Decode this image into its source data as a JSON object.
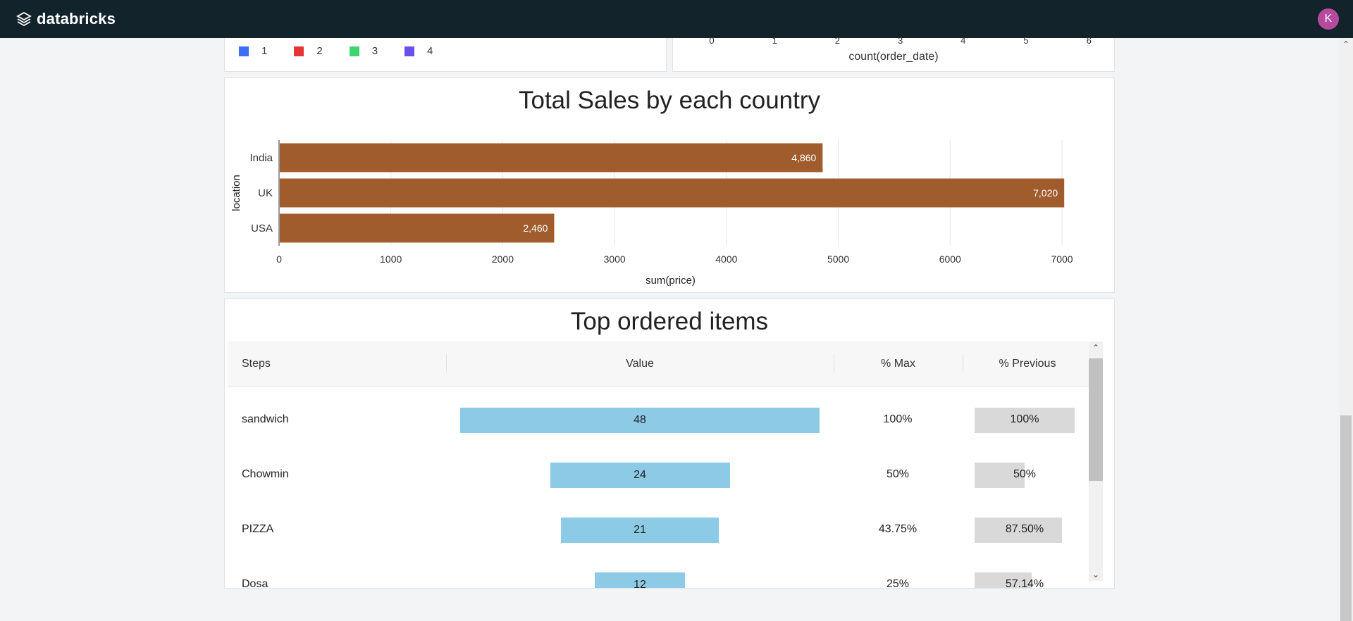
{
  "app": {
    "brand": "databricks",
    "user_initial": "K"
  },
  "colors": {
    "topbar": "#13232c",
    "bar_brown": "#a05c2c",
    "funnel_blue": "#8dcae6",
    "prev_gray": "#d9d9d9",
    "avatar": "#b64a9e"
  },
  "top_left_panel": {
    "legend": [
      {
        "label": "1",
        "color": "#3b6ff5"
      },
      {
        "label": "2",
        "color": "#e53535"
      },
      {
        "label": "3",
        "color": "#3ed46f"
      },
      {
        "label": "4",
        "color": "#6a4fe8"
      }
    ]
  },
  "top_right_panel": {
    "ticks": [
      "0",
      "1",
      "2",
      "3",
      "4",
      "5",
      "6"
    ],
    "xlabel": "count(order_date)"
  },
  "sales_chart": {
    "title": "Total Sales by each country",
    "ylabel": "location",
    "xlabel": "sum(price)",
    "ticks": [
      "0",
      "1000",
      "2000",
      "3000",
      "4000",
      "5000",
      "6000",
      "7000"
    ]
  },
  "chart_data": {
    "type": "bar",
    "orientation": "horizontal",
    "title": "Total Sales by each country",
    "xlabel": "sum(price)",
    "ylabel": "location",
    "categories": [
      "India",
      "UK",
      "USA"
    ],
    "values": [
      4860,
      7020,
      2460
    ],
    "value_labels": [
      "4,860",
      "7,020",
      "2,460"
    ],
    "xlim": [
      0,
      7400
    ],
    "color": "#a05c2c",
    "grid": true
  },
  "funnel": {
    "title": "Top ordered items",
    "headers": {
      "steps": "Steps",
      "value": "Value",
      "pct_max": "% Max",
      "pct_prev": "% Previous"
    },
    "rows": [
      {
        "step": "sandwich",
        "value": "48",
        "pct_max": "100%",
        "pct_prev": "100%",
        "frac_max": 1.0,
        "frac_prev": 1.0
      },
      {
        "step": "Chowmin",
        "value": "24",
        "pct_max": "50%",
        "pct_prev": "50%",
        "frac_max": 0.5,
        "frac_prev": 0.5
      },
      {
        "step": "PIZZA",
        "value": "21",
        "pct_max": "43.75%",
        "pct_prev": "87.50%",
        "frac_max": 0.4375,
        "frac_prev": 0.875
      },
      {
        "step": "Dosa",
        "value": "12",
        "pct_max": "25%",
        "pct_prev": "57.14%",
        "frac_max": 0.25,
        "frac_prev": 0.5714
      }
    ]
  }
}
